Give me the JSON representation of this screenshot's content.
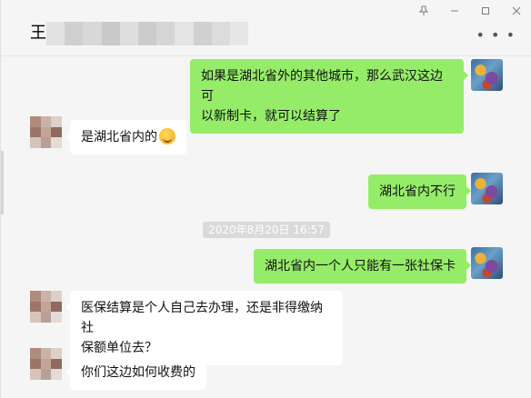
{
  "header": {
    "contact_name": "王"
  },
  "window_controls": {
    "pin_icon": "pin-icon",
    "minimize_icon": "minimize-icon",
    "maximize_icon": "maximize-icon",
    "close_icon": "close-icon"
  },
  "messages": [
    {
      "sender": "self",
      "text_line1": "如果是湖北省外的其他城市，那么武汉这边可",
      "text_line2": "以新制卡，就可以结算了"
    },
    {
      "sender": "other",
      "text": "是湖北省内的"
    },
    {
      "sender": "self",
      "text": "湖北省内不行"
    },
    {
      "sender": "self",
      "text": "湖北省内一个人只能有一张社保卡"
    },
    {
      "sender": "other",
      "text_line1": "医保结算是个人自己去办理，还是非得缴纳社",
      "text_line2": "保额单位去？"
    },
    {
      "sender": "other",
      "text": "你们这边如何收费的"
    }
  ],
  "timestamp": "2020年8月20日 16:57",
  "colors": {
    "outgoing_bubble": "#95ec69",
    "incoming_bubble": "#ffffff",
    "background": "#f5f5f5"
  }
}
